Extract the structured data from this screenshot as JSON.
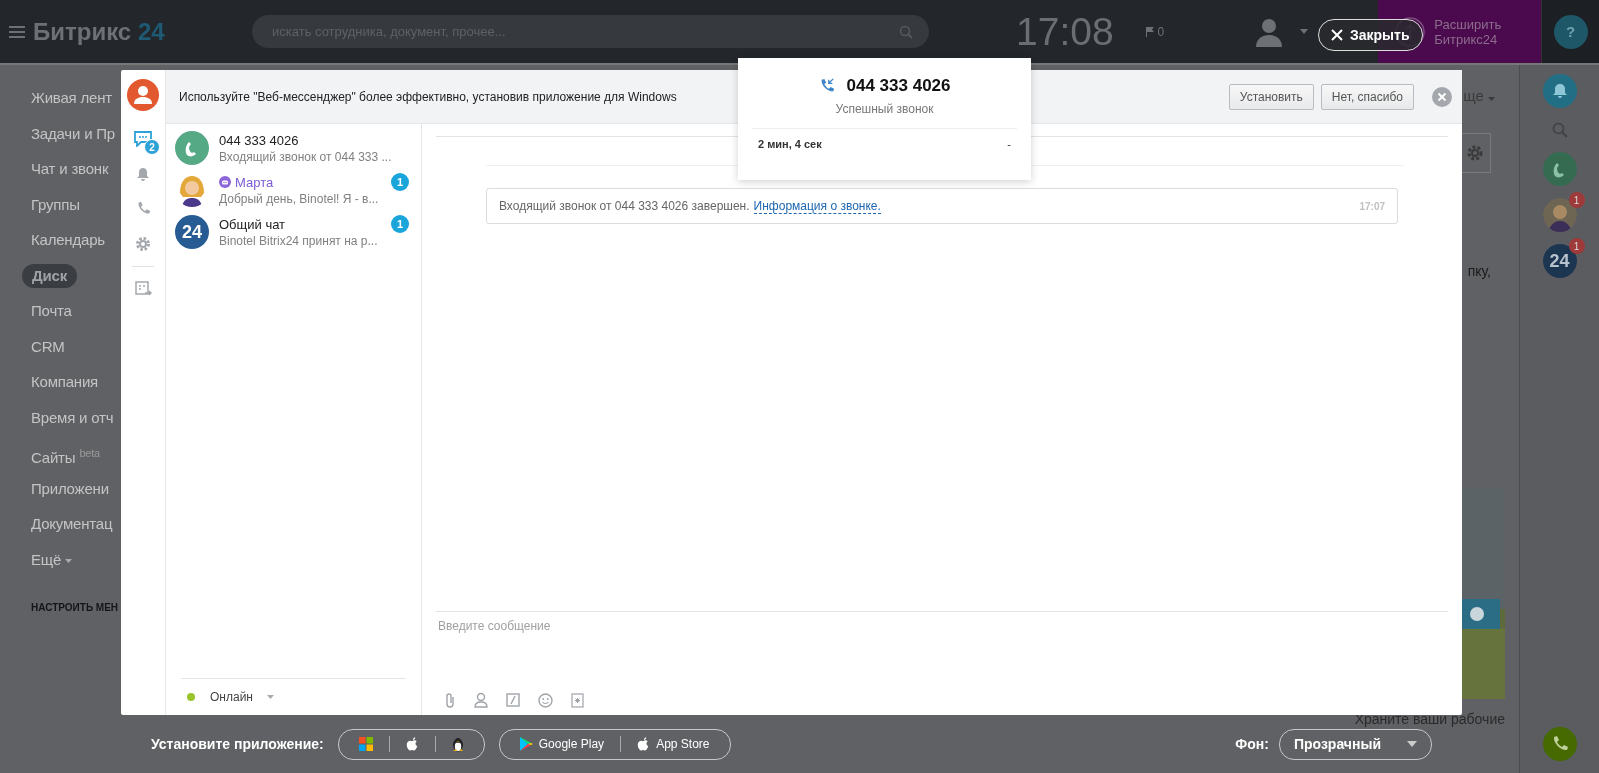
{
  "top_bar": {
    "logo": "Битрикс",
    "logo_accent": "24",
    "search": {
      "placeholder": "искать сотрудника, документ, прочее..."
    },
    "clock": "17:08",
    "flag_count": "0",
    "close_button": "Закрыть",
    "upgrade": "Расширить Битрикс24",
    "help": "?"
  },
  "nav": {
    "items": [
      {
        "label": "Живая лент",
        "selected": false
      },
      {
        "label": "Задачи и Пр",
        "selected": false
      },
      {
        "label": "Чат и звонк",
        "selected": false
      },
      {
        "label": "Группы",
        "selected": false
      },
      {
        "label": "Календарь",
        "selected": false
      },
      {
        "label": "Диск",
        "selected": true
      },
      {
        "label": "Почта",
        "selected": false
      },
      {
        "label": "CRM",
        "selected": false
      },
      {
        "label": "Компания",
        "selected": false
      },
      {
        "label": "Время и отч",
        "selected": false
      },
      {
        "label": "Сайты",
        "superscript": "beta",
        "selected": false
      },
      {
        "label": "Приложени",
        "selected": false
      },
      {
        "label": "Документац",
        "selected": false
      },
      {
        "label": "Ещё",
        "caret": true,
        "selected": false
      }
    ],
    "configure": "НАСТРОИТЬ МЕН"
  },
  "background_fragments": {
    "menu": "ще",
    "text": "пку,",
    "footer": "Храните ваши рабочие"
  },
  "messenger": {
    "rail": [
      {
        "kind": "avatar"
      },
      {
        "kind": "chats",
        "badge": "2",
        "selected": true
      },
      {
        "kind": "notifications",
        "selected": false
      },
      {
        "kind": "calls",
        "selected": false
      },
      {
        "kind": "settings",
        "selected": false
      },
      {
        "kind": "divider"
      },
      {
        "kind": "export",
        "selected": false
      }
    ],
    "banner": {
      "text": "Используйте \"Веб-мессенджер\" более эффективно, установив приложение для Windows",
      "buttons": [
        "Установить",
        "Нет, спасибо"
      ]
    },
    "conversations": [
      {
        "kind": "call",
        "title": "044 333 4026",
        "preview": "Входящий звонок от 044 333 ..."
      },
      {
        "kind": "bot",
        "title": "Марта",
        "preview": "Добрый день, Binotel! Я - в...",
        "unread": "1"
      },
      {
        "kind": "group",
        "avatar_text": "24",
        "title": "Общий чат",
        "preview": "Binotel Bitrix24 принят на р...",
        "unread": "1"
      }
    ],
    "status": "Онлайн",
    "message": {
      "text": "Входящий звонок от 044 333 4026 завершен.",
      "link": "Информация о звонке.",
      "time": "17:07"
    },
    "input": {
      "placeholder": "Введите сообщение"
    }
  },
  "popover": {
    "number": "044 333 4026",
    "status": "Успешный звонок",
    "duration": "2 мин, 4 сек",
    "value": "-"
  },
  "bottom_bar": {
    "install_label": "Установите приложение:",
    "stores": [
      "Google Play",
      "App Store"
    ],
    "background_label": "Фон:",
    "background_value": "Прозрачный"
  },
  "right_rail": [
    {
      "kind": "notifications"
    },
    {
      "kind": "search"
    },
    {
      "kind": "call"
    },
    {
      "kind": "avatar",
      "badge": "1"
    },
    {
      "kind": "group",
      "text": "24",
      "badge": "1"
    },
    {
      "kind": "spacer"
    },
    {
      "kind": "phone"
    }
  ]
}
